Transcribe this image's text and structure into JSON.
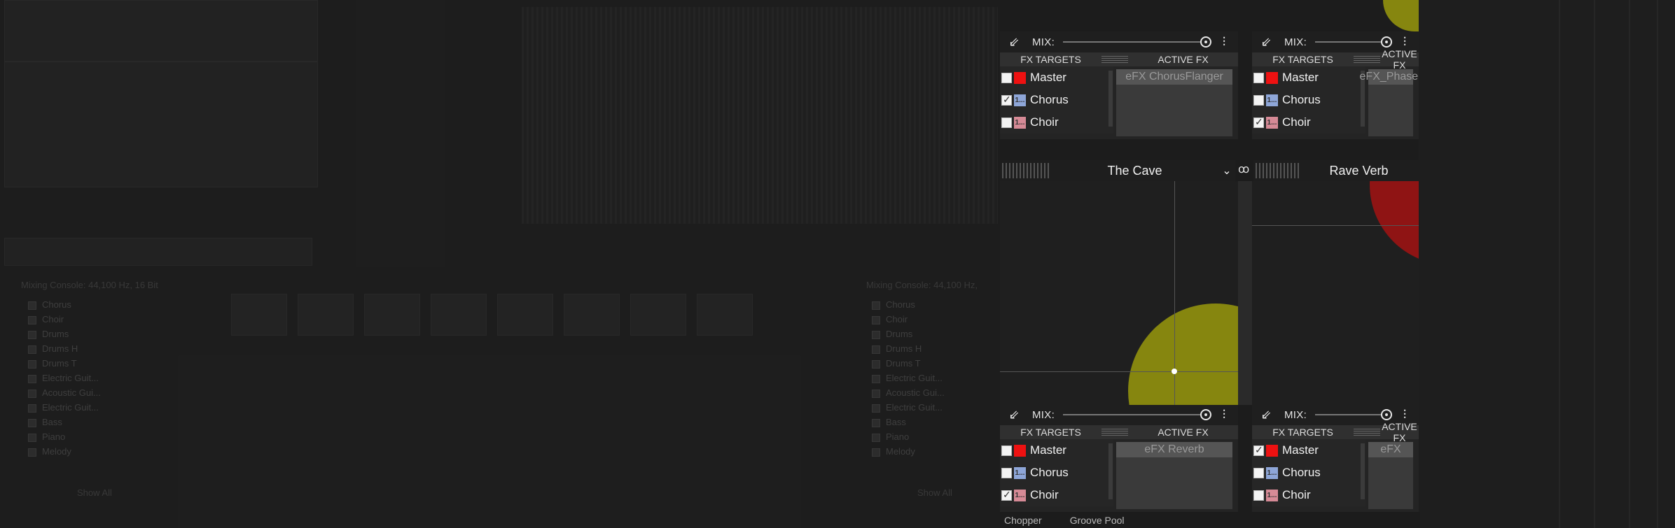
{
  "colors": {
    "accent_red": "#ee1111",
    "accent_yellow": "#86860f",
    "dark_red": "#8f1414"
  },
  "plugin_a_top": {
    "mix_label": "MIX:",
    "fx_targets_header": "FX TARGETS",
    "active_fx_header": "ACTIVE FX",
    "targets": [
      {
        "label": "Master",
        "checked": false,
        "swatch": "red",
        "badge": ""
      },
      {
        "label": "Chorus",
        "checked": true,
        "swatch": "blue",
        "badge": "1..."
      },
      {
        "label": "Choir",
        "checked": false,
        "swatch": "pink",
        "badge": "1..."
      }
    ],
    "active_fx": "eFX ChorusFlanger"
  },
  "plugin_b_top": {
    "mix_label": "MIX:",
    "fx_targets_header": "FX TARGETS",
    "active_fx_header": "ACTIVE FX",
    "targets": [
      {
        "label": "Master",
        "checked": false,
        "swatch": "red",
        "badge": ""
      },
      {
        "label": "Chorus",
        "checked": false,
        "swatch": "blue",
        "badge": "1..."
      },
      {
        "label": "Choir",
        "checked": true,
        "swatch": "pink",
        "badge": "1..."
      }
    ],
    "active_fx": "eFX_Phaser"
  },
  "presets": {
    "left": "The Cave",
    "right": "Rave Verb"
  },
  "plugin_a_bottom": {
    "mix_label": "MIX:",
    "fx_targets_header": "FX TARGETS",
    "active_fx_header": "ACTIVE FX",
    "targets": [
      {
        "label": "Master",
        "checked": false,
        "swatch": "red",
        "badge": ""
      },
      {
        "label": "Chorus",
        "checked": false,
        "swatch": "blue",
        "badge": "1..."
      },
      {
        "label": "Choir",
        "checked": true,
        "swatch": "pink",
        "badge": "1..."
      }
    ],
    "active_fx": "eFX Reverb"
  },
  "plugin_b_bottom": {
    "mix_label": "MIX:",
    "fx_targets_header": "FX TARGETS",
    "active_fx_header": "ACTIVE FX",
    "targets": [
      {
        "label": "Master",
        "checked": true,
        "swatch": "red",
        "badge": ""
      },
      {
        "label": "Chorus",
        "checked": false,
        "swatch": "blue",
        "badge": "1..."
      },
      {
        "label": "Choir",
        "checked": false,
        "swatch": "pink",
        "badge": "1..."
      }
    ],
    "active_fx": "eFX"
  },
  "bottom_tabs": [
    "Chopper",
    "Groove Pool"
  ],
  "background": {
    "mixing_console_title": "Mixing Console: 44,100 Hz, 16 Bit",
    "mixing_console_title_2": "Mixing Console: 44,100 Hz,",
    "track_list": [
      "Chorus",
      "Choir",
      "Drums",
      "Drums H",
      "Drums T",
      "Electric Guit...",
      "Acoustic Gui...",
      "Electric Guit...",
      "Bass",
      "Piano",
      "Melody"
    ],
    "show_all": "Show All"
  }
}
